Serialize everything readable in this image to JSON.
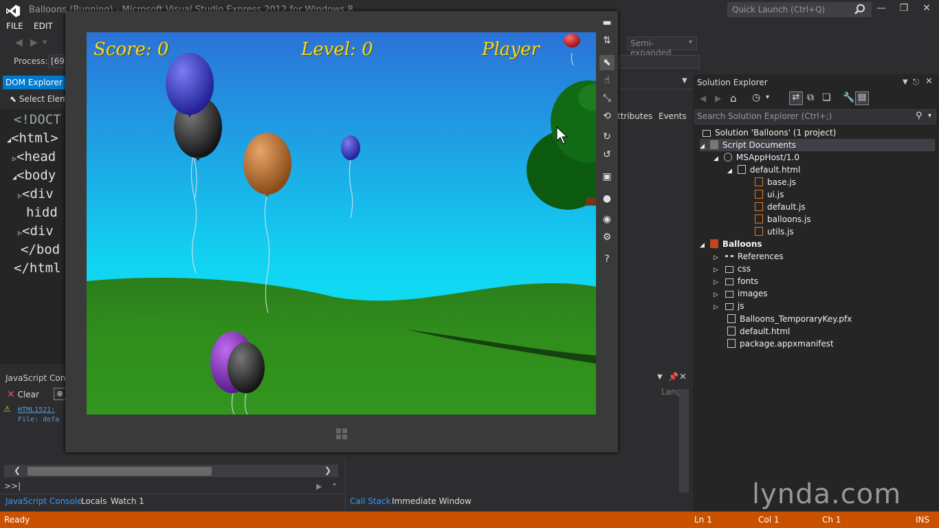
{
  "window": {
    "title": "Balloons (Running) - Microsoft Visual Studio Express 2012 for Windows 8",
    "quick_launch_placeholder": "Quick Launch (Ctrl+Q)"
  },
  "menu": {
    "items": [
      "FILE",
      "EDIT"
    ]
  },
  "toolbar": {
    "process_label": "Process:",
    "process_value": "[69",
    "view_mode": "Semi-expanded"
  },
  "dom_explorer": {
    "tab_label": "DOM Explorer",
    "select_element": "Select Eleme",
    "lines": [
      "<!DOCT",
      "<html>",
      "<head",
      "<body",
      "<div",
      "hidd",
      "<div",
      "</bod",
      "</html"
    ],
    "attributes_label": "ttributes",
    "events_label": "Events"
  },
  "js_console": {
    "title": "JavaScript Conso",
    "clear_label": "Clear",
    "warning_code": "HTML1521:",
    "warning_file": "File: defa",
    "prompt": ">>|",
    "lang_label": "Lang"
  },
  "bottom_tabs_left": [
    "JavaScript Console",
    "Locals",
    "Watch 1"
  ],
  "bottom_tabs_right": [
    "Call Stack",
    "Immediate Window"
  ],
  "solution_explorer": {
    "title": "Solution Explorer",
    "search_placeholder": "Search Solution Explorer (Ctrl+;)",
    "items": [
      {
        "label": "Solution 'Balloons' (1 project)",
        "icon": "solution-icon"
      },
      {
        "label": "Script Documents",
        "icon": "script-documents-icon"
      },
      {
        "label": "MSAppHost/1.0",
        "icon": "globe-icon"
      },
      {
        "label": "default.html",
        "icon": "html-file-icon"
      },
      {
        "label": "base.js",
        "icon": "js-file-icon"
      },
      {
        "label": "ui.js",
        "icon": "js-file-icon"
      },
      {
        "label": "default.js",
        "icon": "js-file-icon"
      },
      {
        "label": "balloons.js",
        "icon": "js-file-icon"
      },
      {
        "label": "utils.js",
        "icon": "js-file-icon"
      },
      {
        "label": "Balloons",
        "icon": "js-project-icon"
      },
      {
        "label": "References",
        "icon": "references-icon"
      },
      {
        "label": "css",
        "icon": "folder-icon"
      },
      {
        "label": "fonts",
        "icon": "folder-icon"
      },
      {
        "label": "images",
        "icon": "folder-icon"
      },
      {
        "label": "js",
        "icon": "folder-icon"
      },
      {
        "label": "Balloons_TemporaryKey.pfx",
        "icon": "certificate-icon"
      },
      {
        "label": "default.html",
        "icon": "html-file-icon"
      },
      {
        "label": "package.appxmanifest",
        "icon": "manifest-icon"
      }
    ]
  },
  "game": {
    "score": "Score: 0",
    "level": "Level: 0",
    "player": "Player"
  },
  "status_bar": {
    "ready": "Ready",
    "ln": "Ln 1",
    "col": "Col 1",
    "ch": "Ch 1",
    "mode": "INS"
  },
  "watermark": "lynda.com",
  "colors": {
    "accent": "#007acc",
    "status_bar": "#ca5100",
    "sky_top": "#2a74d8",
    "sky_bottom": "#10e6f4",
    "grass": "#2e8a1c",
    "hud_text": "#f3d92e"
  }
}
